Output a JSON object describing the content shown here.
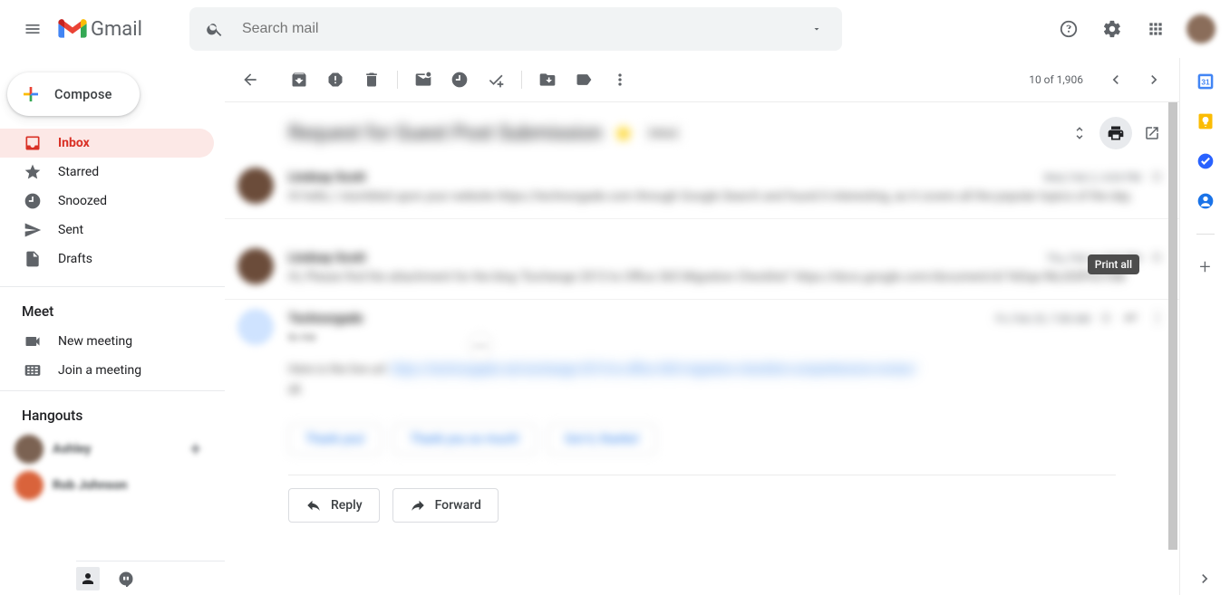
{
  "header": {
    "app_name": "Gmail",
    "search_placeholder": "Search mail"
  },
  "compose_label": "Compose",
  "nav": {
    "inbox": "Inbox",
    "starred": "Starred",
    "snoozed": "Snoozed",
    "sent": "Sent",
    "drafts": "Drafts"
  },
  "meet": {
    "title": "Meet",
    "new_meeting": "New meeting",
    "join_meeting": "Join a meeting"
  },
  "hangouts": {
    "title": "Hangouts",
    "user1": "Ashley",
    "user2": "Rob Johnson"
  },
  "toolbar": {
    "count_text": "10 of 1,906"
  },
  "tooltip_print": "Print all",
  "thread": {
    "subject": "Request for Guest Post Submission",
    "label": "Inbox",
    "msg1": {
      "sender": "Lindsay Scott",
      "date": "Wed, Feb 2, 4:04 PM",
      "preview": "Hi hello, I stumbled upon your website https://technorgade.com through Google Search and found it interesting, as it covers all the popular topics of the day."
    },
    "msg2": {
      "sender": "Lindsay Scott",
      "date": "Thu, Feb 3, 3:07 PM",
      "preview": "Hi, Please find the attachment for the blog \"Exchange 2013 to Office 365 Migration Checklist\" https://docs.google.com/document/d/1kDqa-9kLt03FhO7DB"
    },
    "msg3": {
      "sender": "Technorgade",
      "to": "to me",
      "date": "Fri, Feb 25, 7:08 AM",
      "body_plain": "Here is the live url: ",
      "body_link": "https://technorgade.net/exchange-2013-to-office-365-migration-checklist-comprehensive-review/",
      "body_tail": "ak"
    },
    "smart_replies": {
      "r1": "Thank you!",
      "r2": "Thank you so much!",
      "r3": "Got it, thanks!"
    }
  },
  "actions": {
    "reply": "Reply",
    "forward": "Forward"
  },
  "side_apps": {
    "calendar_day": "31"
  }
}
